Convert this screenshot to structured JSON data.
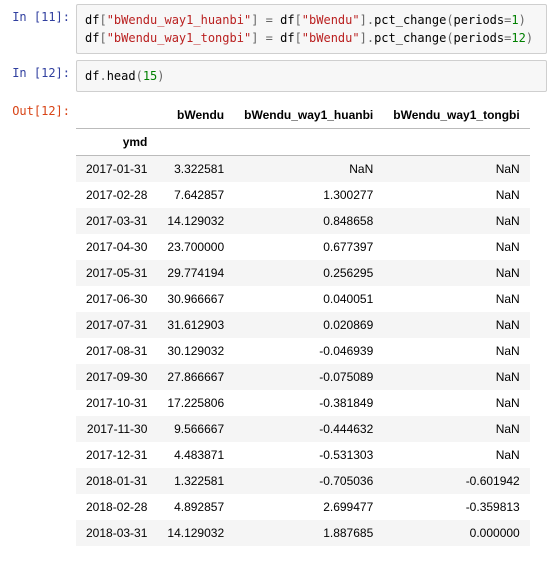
{
  "cells": {
    "c11": {
      "in_prompt": "In [11]:",
      "code": {
        "l1": {
          "v": "df",
          "o1": "[",
          "s1": "\"bWendu_way1_huanbi\"",
          "o2": "]",
          "eq": " = ",
          "v2": "df",
          "o3": "[",
          "s2": "\"bWendu\"",
          "o4": "]",
          "dot": ".",
          "fn": "pct_change",
          "p1": "(",
          "kw": "periods",
          "eq2": "=",
          "n": "1",
          "p2": ")"
        },
        "l2": {
          "v": "df",
          "o1": "[",
          "s1": "\"bWendu_way1_tongbi\"",
          "o2": "]",
          "eq": " = ",
          "v2": "df",
          "o3": "[",
          "s2": "\"bWendu\"",
          "o4": "]",
          "dot": ".",
          "fn": "pct_change",
          "p1": "(",
          "kw": "periods",
          "eq2": "=",
          "n": "12",
          "p2": ")"
        }
      }
    },
    "c12": {
      "in_prompt": "In [12]:",
      "out_prompt": "Out[12]:",
      "code": {
        "l1": {
          "v": "df",
          "dot": ".",
          "fn": "head",
          "p1": "(",
          "n": "15",
          "p2": ")"
        }
      }
    }
  },
  "table": {
    "index_name": "ymd",
    "columns": [
      "bWendu",
      "bWendu_way1_huanbi",
      "bWendu_way1_tongbi"
    ],
    "rows": [
      {
        "ymd": "2017-01-31",
        "bWendu": "3.322581",
        "huanbi": "NaN",
        "tongbi": "NaN"
      },
      {
        "ymd": "2017-02-28",
        "bWendu": "7.642857",
        "huanbi": "1.300277",
        "tongbi": "NaN"
      },
      {
        "ymd": "2017-03-31",
        "bWendu": "14.129032",
        "huanbi": "0.848658",
        "tongbi": "NaN"
      },
      {
        "ymd": "2017-04-30",
        "bWendu": "23.700000",
        "huanbi": "0.677397",
        "tongbi": "NaN"
      },
      {
        "ymd": "2017-05-31",
        "bWendu": "29.774194",
        "huanbi": "0.256295",
        "tongbi": "NaN"
      },
      {
        "ymd": "2017-06-30",
        "bWendu": "30.966667",
        "huanbi": "0.040051",
        "tongbi": "NaN"
      },
      {
        "ymd": "2017-07-31",
        "bWendu": "31.612903",
        "huanbi": "0.020869",
        "tongbi": "NaN"
      },
      {
        "ymd": "2017-08-31",
        "bWendu": "30.129032",
        "huanbi": "-0.046939",
        "tongbi": "NaN"
      },
      {
        "ymd": "2017-09-30",
        "bWendu": "27.866667",
        "huanbi": "-0.075089",
        "tongbi": "NaN"
      },
      {
        "ymd": "2017-10-31",
        "bWendu": "17.225806",
        "huanbi": "-0.381849",
        "tongbi": "NaN"
      },
      {
        "ymd": "2017-11-30",
        "bWendu": "9.566667",
        "huanbi": "-0.444632",
        "tongbi": "NaN"
      },
      {
        "ymd": "2017-12-31",
        "bWendu": "4.483871",
        "huanbi": "-0.531303",
        "tongbi": "NaN"
      },
      {
        "ymd": "2018-01-31",
        "bWendu": "1.322581",
        "huanbi": "-0.705036",
        "tongbi": "-0.601942"
      },
      {
        "ymd": "2018-02-28",
        "bWendu": "4.892857",
        "huanbi": "2.699477",
        "tongbi": "-0.359813"
      },
      {
        "ymd": "2018-03-31",
        "bWendu": "14.129032",
        "huanbi": "1.887685",
        "tongbi": "0.000000"
      }
    ]
  }
}
